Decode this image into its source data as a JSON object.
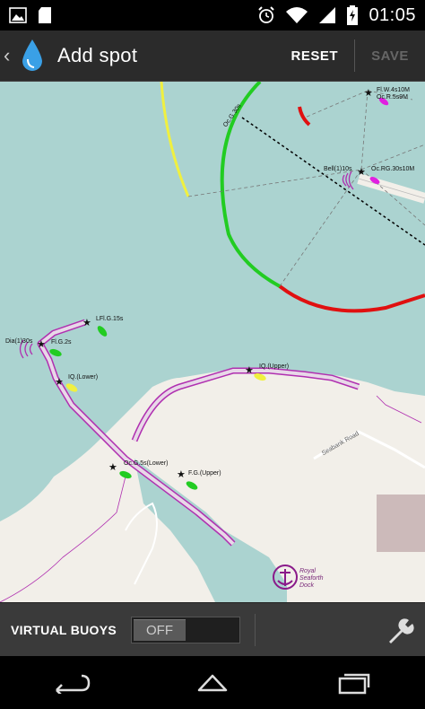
{
  "status_bar": {
    "time": "01:05"
  },
  "action_bar": {
    "back": "‹",
    "title": "Add spot",
    "reset_label": "RESET",
    "save_label": "SAVE"
  },
  "map": {
    "labels": {
      "fl_w": "Fl.W.4s10M",
      "oc_r": "Oc.R.5s9M",
      "oc_g_3": "Oc.G.30s",
      "bell": "Bell(1)10s",
      "oc_rg": "Oc.RG.30s10M",
      "lfl_g": "LFl.G.15s",
      "dia": "Dia(1)30s",
      "fl_g": "Fl.G.2s",
      "iq_lower": "IQ.(Lower)",
      "iq_upper": "IQ.(Upper)",
      "oc_g_lower": "Oc.G.5s(Lower)",
      "fg_upper": "F.G.(Upper)",
      "road": "Seabank Road",
      "dock": [
        "Royal",
        "Seaforth",
        "Dock"
      ]
    },
    "colors": {
      "water": "#abd3d0",
      "land": "#f2efe9",
      "light_green": "#22cc22",
      "light_red": "#e01010",
      "light_yellow": "#f0f040",
      "purple": "#b030b0"
    }
  },
  "control_bar": {
    "virtual_buoys_label": "VIRTUAL BUOYS",
    "toggle_state": "OFF"
  }
}
